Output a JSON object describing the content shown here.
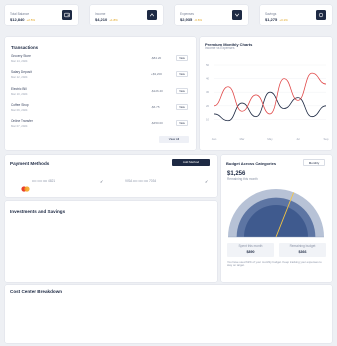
{
  "kpis": [
    {
      "label": "Total Balance",
      "value": "$12,840",
      "change": "+2.5%"
    },
    {
      "label": "Income",
      "value": "$4,210",
      "change": "+1.8%"
    },
    {
      "label": "Expenses",
      "value": "$2,935",
      "change": "-0.6%"
    },
    {
      "label": "Savings",
      "value": "$1,275",
      "change": "+3.1%"
    }
  ],
  "transactions": {
    "title": "Transactions",
    "rows": [
      {
        "name": "Grocery Store",
        "date": "Mar 14, 2024",
        "amount": "-$84.20",
        "action": "View"
      },
      {
        "name": "Salary Deposit",
        "date": "Mar 12, 2024",
        "amount": "+$3,200",
        "action": "View"
      },
      {
        "name": "Electric Bill",
        "date": "Mar 10, 2024",
        "amount": "-$126.40",
        "action": "View"
      },
      {
        "name": "Coffee Shop",
        "date": "Mar 09, 2024",
        "amount": "-$6.75",
        "action": "View"
      },
      {
        "name": "Online Transfer",
        "date": "Mar 07, 2024",
        "amount": "-$450.00",
        "action": "View"
      }
    ],
    "view_all": "View All"
  },
  "cashflow": {
    "title": "Premium Monthly Charts",
    "subtitle": "Income vs Expenses",
    "y_ticks": [
      "50",
      "40",
      "30",
      "20",
      "10"
    ],
    "x_ticks": [
      "Jan",
      "Mar",
      "May",
      "Jul",
      "Sep"
    ],
    "colors": {
      "income": "#1e2a44",
      "expense": "#e14b4b"
    }
  },
  "chart_data": {
    "type": "line",
    "x": [
      "Jan",
      "Feb",
      "Mar",
      "Apr",
      "May",
      "Jun",
      "Jul",
      "Aug",
      "Sep"
    ],
    "ylim": [
      0,
      50
    ],
    "series": [
      {
        "values": [
          14,
          9,
          22,
          12,
          30,
          18,
          26,
          12,
          20
        ]
      },
      {
        "values": [
          20,
          34,
          16,
          28,
          14,
          40,
          24,
          44,
          36
        ]
      }
    ]
  },
  "payment": {
    "title": "Payment Methods",
    "add_label": "Add Method",
    "card1": "•••• •••• •••• 4821",
    "card2": "VISA •••• •••• •••• 7034",
    "check": "✓"
  },
  "budget": {
    "title": "Budget Across Categories",
    "filter": "Monthly",
    "amount": "$1,256",
    "amount_sub": "Remaining this month",
    "gauge_fraction": 0.62,
    "stat1_label": "Spent this month",
    "stat1_value": "$890",
    "stat2_label": "Remaining budget",
    "stat2_value": "$366",
    "note": "You have used 62% of your monthly budget. Keep tracking your expenses to stay on target."
  },
  "investments": {
    "title": "Investments and Savings"
  },
  "cost_center": {
    "title": "Cost Center Breakdown"
  }
}
